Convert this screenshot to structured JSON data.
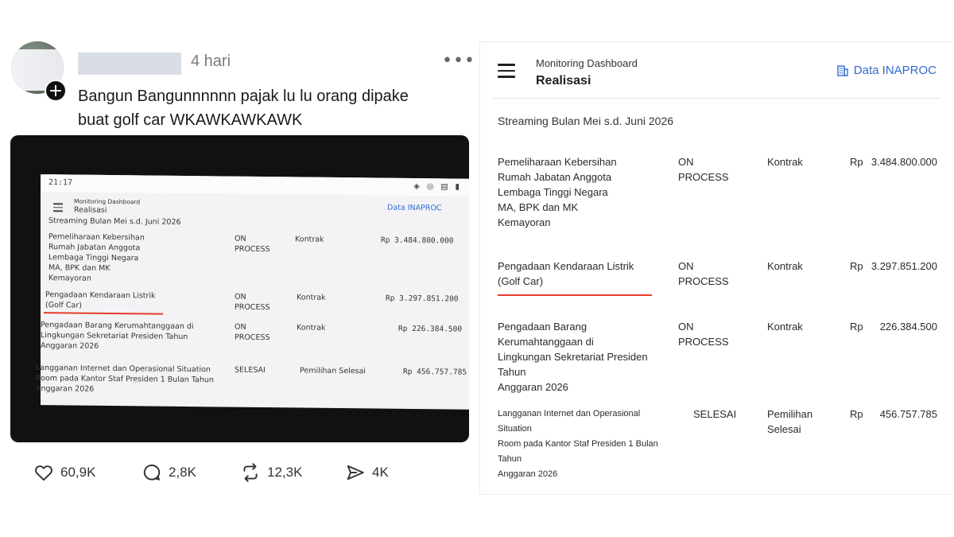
{
  "post": {
    "time": "4 hari",
    "more": "•••",
    "avatar_badge": "+",
    "text_line1": "Bangun Bangunnnnnn pajak lu lu orang dipake",
    "text_line2": "buat golf car WKAWKAWKAWK",
    "actions": {
      "likes": "60,9K",
      "replies": "2,8K",
      "reposts": "12,3K",
      "shares": "4K"
    },
    "icons": [
      "heart-icon",
      "comment-icon",
      "repost-icon",
      "share-icon"
    ],
    "photo": {
      "status_time": "21:17",
      "status_icons": "◈ ◎ ▤ ▮",
      "sub": "Monitoring Dashboard",
      "title": "Realisasi",
      "link": "Data INAPROC",
      "stream": "Streaming Bulan Mei s.d. Juni 2026",
      "rows": [
        {
          "l1": "Pemeliharaan Kebersihan",
          "l2": "Rumah Jabatan Anggota",
          "l3": "Lembaga Tinggi Negara",
          "l4": "MA, BPK dan MK",
          "l5": "Kemayoran",
          "status1": "ON",
          "status2": "PROCESS",
          "type": "Kontrak",
          "amount": "Rp 3.484.800.000"
        },
        {
          "l1": "Pengadaan Kendaraan Listrik",
          "l2": "(Golf Car)",
          "status1": "ON",
          "status2": "PROCESS",
          "type": "Kontrak",
          "amount": "Rp 3.297.851.200"
        },
        {
          "l1": "Pengadaan Barang Kerumahtanggaan di",
          "l2": "Lingkungan Sekretariat Presiden Tahun",
          "l3": "Anggaran 2026",
          "status1": "ON",
          "status2": "PROCESS",
          "type": "Kontrak",
          "amount": "Rp 226.384.500"
        },
        {
          "l1": "Langganan Internet dan Operasional Situation",
          "l2": "Room pada Kantor Staf Presiden 1 Bulan Tahun",
          "l3": "Anggaran 2026",
          "status1": "SELESAI",
          "type": "Pemilihan Selesai",
          "amount": "Rp 456.757.785"
        }
      ]
    }
  },
  "dashboard": {
    "subtitle": "Monitoring Dashboard",
    "title": "Realisasi",
    "link_label": "Data INAPROC",
    "stream_label": "Streaming Bulan Mei s.d. Juni 2026",
    "currency": "Rp",
    "rows": [
      {
        "desc": [
          "Pemeliharaan Kebersihan",
          "Rumah Jabatan Anggota",
          "Lembaga Tinggi Negara",
          "MA, BPK dan MK",
          "Kemayoran"
        ],
        "status": [
          "ON",
          "PROCESS"
        ],
        "type": [
          "Kontrak"
        ],
        "amount": "3.484.800.000"
      },
      {
        "desc": [
          "Pengadaan Kendaraan Listrik",
          "(Golf Car)"
        ],
        "status": [
          "ON",
          "PROCESS"
        ],
        "type": [
          "Kontrak"
        ],
        "amount": "3.297.851.200"
      },
      {
        "desc": [
          "Pengadaan Barang Kerumahtanggaan di",
          "Lingkungan Sekretariat Presiden Tahun",
          "Anggaran 2026"
        ],
        "status": [
          "ON",
          "PROCESS"
        ],
        "type": [
          "Kontrak"
        ],
        "amount": "226.384.500"
      },
      {
        "desc": [
          "Langganan Internet dan Operasional Situation",
          "Room pada Kantor Staf Presiden 1 Bulan Tahun",
          "Anggaran 2026"
        ],
        "status": [
          "SELESAI"
        ],
        "type": [
          "Pemilihan",
          "Selesai"
        ],
        "amount": "456.757.785"
      }
    ]
  },
  "colors": {
    "link": "#2f6bd0",
    "underline": "#e53a2c"
  }
}
